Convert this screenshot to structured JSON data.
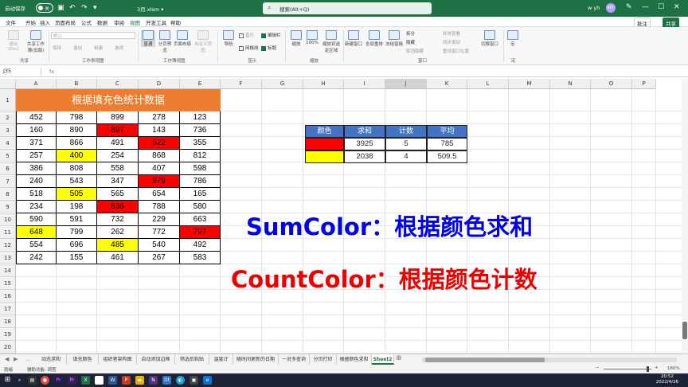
{
  "titlebar": {
    "autosave_label": "自动保存",
    "autosave_state": "关",
    "filename": "3月.xlsm ▾",
    "search_placeholder": "搜索(Alt+Q)",
    "user_name": "w yh",
    "user_initials": "WY"
  },
  "menubar": {
    "tabs": [
      "文件",
      "开始",
      "插入",
      "页面布局",
      "公式",
      "数据",
      "审阅",
      "视图",
      "开发工具",
      "帮助"
    ],
    "active": "视图",
    "comment_label": "批注",
    "share_label": "共享"
  },
  "ribbon": {
    "buttons": [
      {
        "label": "退出(Esc)",
        "sub": "删除/取消"
      },
      {
        "label": "共享工作簿(旧版)"
      },
      {
        "label": "保持"
      },
      {
        "label": "退出"
      },
      {
        "label": "新建"
      },
      {
        "label": "选项"
      },
      {
        "label": "普通"
      },
      {
        "label": "分页预览"
      },
      {
        "label": "页面布局"
      },
      {
        "label": "自定义视图"
      },
      {
        "label": "导航"
      },
      {
        "label": "直尺"
      },
      {
        "label": "编辑栏"
      },
      {
        "label": "网格线"
      },
      {
        "label": "标题"
      },
      {
        "label": "缩放"
      },
      {
        "label": "100%"
      },
      {
        "label": "缩放到选定区域"
      },
      {
        "label": "新建窗口"
      },
      {
        "label": "全部重排"
      },
      {
        "label": "冻结窗格"
      },
      {
        "label": "拆分"
      },
      {
        "label": "隐藏"
      },
      {
        "label": "取消隐藏"
      },
      {
        "label": "并排查看"
      },
      {
        "label": "同步滚动"
      },
      {
        "label": "重设窗口位置"
      },
      {
        "label": "切换窗口"
      },
      {
        "label": "宏"
      }
    ],
    "sheet_view_dropdown": "默认",
    "groups": [
      "共享",
      "工作表视图",
      "工作簿视图",
      "显示",
      "缩放",
      "窗口",
      "宏"
    ]
  },
  "formula_bar": {
    "name_box": "J35",
    "fx": "fx",
    "value": ""
  },
  "columns": [
    "A",
    "B",
    "C",
    "D",
    "E",
    "F",
    "G",
    "H",
    "I",
    "J",
    "K",
    "L",
    "M",
    "N",
    "O",
    "P"
  ],
  "selected_column": "J",
  "rows": [
    "1",
    "2",
    "3",
    "4",
    "5",
    "6",
    "7",
    "8",
    "9",
    "10",
    "11",
    "12",
    "13",
    "14",
    "15",
    "16",
    "17",
    "18",
    "19",
    "20",
    "21"
  ],
  "sheet": {
    "title": "根据填充色统计数据",
    "data": [
      [
        "452",
        "798",
        "899",
        "278",
        "123"
      ],
      [
        "160",
        "890",
        "897",
        "143",
        "736"
      ],
      [
        "371",
        "866",
        "491",
        "522",
        "355"
      ],
      [
        "257",
        "400",
        "254",
        "868",
        "812"
      ],
      [
        "386",
        "808",
        "558",
        "407",
        "598"
      ],
      [
        "240",
        "543",
        "347",
        "879",
        "786"
      ],
      [
        "518",
        "505",
        "565",
        "654",
        "165"
      ],
      [
        "234",
        "198",
        "836",
        "788",
        "580"
      ],
      [
        "590",
        "591",
        "732",
        "229",
        "663"
      ],
      [
        "648",
        "799",
        "262",
        "772",
        "797"
      ],
      [
        "554",
        "696",
        "485",
        "540",
        "492"
      ],
      [
        "242",
        "155",
        "461",
        "267",
        "583"
      ]
    ],
    "fills": [
      [
        "",
        "",
        "",
        "",
        ""
      ],
      [
        "",
        "",
        "red",
        "",
        ""
      ],
      [
        "",
        "",
        "",
        "red",
        ""
      ],
      [
        "",
        "yellow",
        "",
        "",
        ""
      ],
      [
        "",
        "",
        "",
        "",
        ""
      ],
      [
        "",
        "",
        "",
        "red",
        ""
      ],
      [
        "",
        "yellow",
        "",
        "",
        ""
      ],
      [
        "",
        "",
        "red",
        "",
        ""
      ],
      [
        "",
        "",
        "",
        "",
        ""
      ],
      [
        "yellow",
        "",
        "",
        "",
        "red"
      ],
      [
        "",
        "",
        "yellow",
        "",
        ""
      ],
      [
        "",
        "",
        "",
        "",
        ""
      ]
    ],
    "colors": {
      "red": "#ff0000",
      "yellow": "#ffff00",
      "header": "#ed7d31",
      "table_header": "#4472c4"
    }
  },
  "summary_table": {
    "headers": [
      "颜色",
      "求和",
      "计数",
      "平均"
    ],
    "rows": [
      {
        "color": "red",
        "sum": "3925",
        "count": "5",
        "avg": "785"
      },
      {
        "color": "yellow",
        "sum": "2038",
        "count": "4",
        "avg": "509.5"
      }
    ]
  },
  "annotations": {
    "sumcolor": "SumColor：根据颜色求和",
    "sumcolor_color": "#0000ee",
    "countcolor": "CountColor：根据颜色计数",
    "countcolor_color": "#ee0000"
  },
  "sheet_tabs": [
    "动态求和",
    "填充颜色",
    "组织者架构图",
    "自动添加边框",
    "筛选后粘贴",
    "温度计",
    "随时间更新的日期",
    "一对多查询",
    "分页打印",
    "根据颜色求和",
    "Sheet2"
  ],
  "active_sheet": "Sheet2",
  "statusbar": {
    "ready": "就绪",
    "accessibility": "辅助功能: 调查",
    "zoom": "160%"
  },
  "taskbar": {
    "time": "20:52",
    "date": "2022/4/26"
  }
}
